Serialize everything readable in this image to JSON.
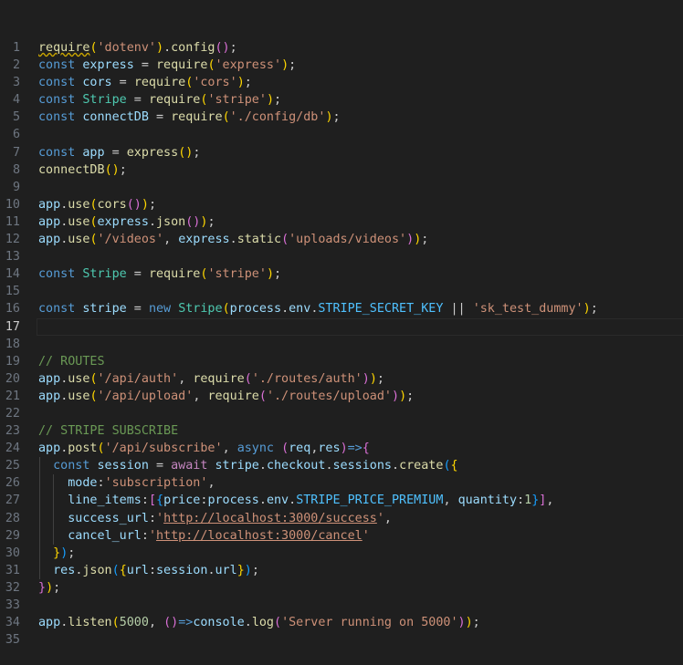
{
  "editor": {
    "current_line": 17,
    "lines": [
      {
        "n": "1",
        "tokens": [
          [
            "fn",
            "require"
          ],
          [
            "b1",
            "("
          ],
          [
            "str",
            "'dotenv'"
          ],
          [
            "b1",
            ")"
          ],
          [
            "pun",
            "."
          ],
          [
            "fn",
            "config"
          ],
          [
            "b2",
            "()"
          ],
          [
            "pun",
            ";"
          ]
        ]
      },
      {
        "n": "2",
        "tokens": [
          [
            "kw",
            "const"
          ],
          [
            "pun",
            " "
          ],
          [
            "var",
            "express"
          ],
          [
            "pun",
            " = "
          ],
          [
            "fn",
            "require"
          ],
          [
            "b1",
            "("
          ],
          [
            "str",
            "'express'"
          ],
          [
            "b1",
            ")"
          ],
          [
            "pun",
            ";"
          ]
        ]
      },
      {
        "n": "3",
        "tokens": [
          [
            "kw",
            "const"
          ],
          [
            "pun",
            " "
          ],
          [
            "var",
            "cors"
          ],
          [
            "pun",
            " = "
          ],
          [
            "fn",
            "require"
          ],
          [
            "b1",
            "("
          ],
          [
            "str",
            "'cors'"
          ],
          [
            "b1",
            ")"
          ],
          [
            "pun",
            ";"
          ]
        ]
      },
      {
        "n": "4",
        "tokens": [
          [
            "kw",
            "const"
          ],
          [
            "pun",
            " "
          ],
          [
            "cls",
            "Stripe"
          ],
          [
            "pun",
            " = "
          ],
          [
            "fn",
            "require"
          ],
          [
            "b1",
            "("
          ],
          [
            "str",
            "'stripe'"
          ],
          [
            "b1",
            ")"
          ],
          [
            "pun",
            ";"
          ]
        ]
      },
      {
        "n": "5",
        "tokens": [
          [
            "kw",
            "const"
          ],
          [
            "pun",
            " "
          ],
          [
            "var",
            "connectDB"
          ],
          [
            "pun",
            " = "
          ],
          [
            "fn",
            "require"
          ],
          [
            "b1",
            "("
          ],
          [
            "str",
            "'./config/db'"
          ],
          [
            "b1",
            ")"
          ],
          [
            "pun",
            ";"
          ]
        ]
      },
      {
        "n": "6",
        "tokens": []
      },
      {
        "n": "7",
        "tokens": [
          [
            "kw",
            "const"
          ],
          [
            "pun",
            " "
          ],
          [
            "var",
            "app"
          ],
          [
            "pun",
            " = "
          ],
          [
            "fn",
            "express"
          ],
          [
            "b1",
            "()"
          ],
          [
            "pun",
            ";"
          ]
        ]
      },
      {
        "n": "8",
        "tokens": [
          [
            "fn",
            "connectDB"
          ],
          [
            "b1",
            "()"
          ],
          [
            "pun",
            ";"
          ]
        ]
      },
      {
        "n": "9",
        "tokens": []
      },
      {
        "n": "10",
        "tokens": [
          [
            "var",
            "app"
          ],
          [
            "pun",
            "."
          ],
          [
            "fn",
            "use"
          ],
          [
            "b1",
            "("
          ],
          [
            "fn",
            "cors"
          ],
          [
            "b2",
            "()"
          ],
          [
            "b1",
            ")"
          ],
          [
            "pun",
            ";"
          ]
        ]
      },
      {
        "n": "11",
        "tokens": [
          [
            "var",
            "app"
          ],
          [
            "pun",
            "."
          ],
          [
            "fn",
            "use"
          ],
          [
            "b1",
            "("
          ],
          [
            "var",
            "express"
          ],
          [
            "pun",
            "."
          ],
          [
            "fn",
            "json"
          ],
          [
            "b2",
            "()"
          ],
          [
            "b1",
            ")"
          ],
          [
            "pun",
            ";"
          ]
        ]
      },
      {
        "n": "12",
        "tokens": [
          [
            "var",
            "app"
          ],
          [
            "pun",
            "."
          ],
          [
            "fn",
            "use"
          ],
          [
            "b1",
            "("
          ],
          [
            "str",
            "'/videos'"
          ],
          [
            "pun",
            ", "
          ],
          [
            "var",
            "express"
          ],
          [
            "pun",
            "."
          ],
          [
            "fn",
            "static"
          ],
          [
            "b2",
            "("
          ],
          [
            "str",
            "'uploads/videos'"
          ],
          [
            "b2",
            ")"
          ],
          [
            "b1",
            ")"
          ],
          [
            "pun",
            ";"
          ]
        ]
      },
      {
        "n": "13",
        "tokens": []
      },
      {
        "n": "14",
        "tokens": [
          [
            "kw",
            "const"
          ],
          [
            "pun",
            " "
          ],
          [
            "cls",
            "Stripe"
          ],
          [
            "pun",
            " = "
          ],
          [
            "fn",
            "require"
          ],
          [
            "b1",
            "("
          ],
          [
            "str",
            "'stripe'"
          ],
          [
            "b1",
            ")"
          ],
          [
            "pun",
            ";"
          ]
        ]
      },
      {
        "n": "15",
        "tokens": []
      },
      {
        "n": "16",
        "tokens": [
          [
            "kw",
            "const"
          ],
          [
            "pun",
            " "
          ],
          [
            "var",
            "stripe"
          ],
          [
            "pun",
            " = "
          ],
          [
            "kw",
            "new"
          ],
          [
            "pun",
            " "
          ],
          [
            "cls",
            "Stripe"
          ],
          [
            "b1",
            "("
          ],
          [
            "var",
            "process"
          ],
          [
            "pun",
            "."
          ],
          [
            "var",
            "env"
          ],
          [
            "pun",
            "."
          ],
          [
            "const",
            "STRIPE_SECRET_KEY"
          ],
          [
            "pun",
            " || "
          ],
          [
            "str",
            "'sk_test_dummy'"
          ],
          [
            "b1",
            ")"
          ],
          [
            "pun",
            ";"
          ]
        ]
      },
      {
        "n": "17",
        "tokens": []
      },
      {
        "n": "18",
        "tokens": []
      },
      {
        "n": "19",
        "tokens": [
          [
            "cmt",
            "// ROUTES"
          ]
        ]
      },
      {
        "n": "20",
        "tokens": [
          [
            "var",
            "app"
          ],
          [
            "pun",
            "."
          ],
          [
            "fn",
            "use"
          ],
          [
            "b1",
            "("
          ],
          [
            "str",
            "'/api/auth'"
          ],
          [
            "pun",
            ", "
          ],
          [
            "fn",
            "require"
          ],
          [
            "b2",
            "("
          ],
          [
            "str",
            "'./routes/auth'"
          ],
          [
            "b2",
            ")"
          ],
          [
            "b1",
            ")"
          ],
          [
            "pun",
            ";"
          ]
        ]
      },
      {
        "n": "21",
        "tokens": [
          [
            "var",
            "app"
          ],
          [
            "pun",
            "."
          ],
          [
            "fn",
            "use"
          ],
          [
            "b1",
            "("
          ],
          [
            "str",
            "'/api/upload'"
          ],
          [
            "pun",
            ", "
          ],
          [
            "fn",
            "require"
          ],
          [
            "b2",
            "("
          ],
          [
            "str",
            "'./routes/upload'"
          ],
          [
            "b2",
            ")"
          ],
          [
            "b1",
            ")"
          ],
          [
            "pun",
            ";"
          ]
        ]
      },
      {
        "n": "22",
        "tokens": []
      },
      {
        "n": "23",
        "tokens": [
          [
            "cmt",
            "// STRIPE SUBSCRIBE"
          ]
        ]
      },
      {
        "n": "24",
        "tokens": [
          [
            "var",
            "app"
          ],
          [
            "pun",
            "."
          ],
          [
            "fn",
            "post"
          ],
          [
            "b1",
            "("
          ],
          [
            "str",
            "'/api/subscribe'"
          ],
          [
            "pun",
            ", "
          ],
          [
            "kw",
            "async"
          ],
          [
            "pun",
            " "
          ],
          [
            "b2",
            "("
          ],
          [
            "var",
            "req"
          ],
          [
            "pun",
            ","
          ],
          [
            "var",
            "res"
          ],
          [
            "b2",
            ")"
          ],
          [
            "kw",
            "=>"
          ],
          [
            "b2",
            "{"
          ]
        ]
      },
      {
        "n": "25",
        "tokens": [
          [
            "pun",
            "  "
          ],
          [
            "kw",
            "const"
          ],
          [
            "pun",
            " "
          ],
          [
            "var",
            "session"
          ],
          [
            "pun",
            " = "
          ],
          [
            "kw2",
            "await"
          ],
          [
            "pun",
            " "
          ],
          [
            "var",
            "stripe"
          ],
          [
            "pun",
            "."
          ],
          [
            "var",
            "checkout"
          ],
          [
            "pun",
            "."
          ],
          [
            "var",
            "sessions"
          ],
          [
            "pun",
            "."
          ],
          [
            "fn",
            "create"
          ],
          [
            "b3",
            "("
          ],
          [
            "b1",
            "{"
          ]
        ]
      },
      {
        "n": "26",
        "tokens": [
          [
            "pun",
            "    "
          ],
          [
            "var",
            "mode"
          ],
          [
            "pun",
            ":"
          ],
          [
            "str",
            "'subscription'"
          ],
          [
            "pun",
            ","
          ]
        ]
      },
      {
        "n": "27",
        "tokens": [
          [
            "pun",
            "    "
          ],
          [
            "var",
            "line_items"
          ],
          [
            "pun",
            ":"
          ],
          [
            "b2",
            "["
          ],
          [
            "b3",
            "{"
          ],
          [
            "var",
            "price"
          ],
          [
            "pun",
            ":"
          ],
          [
            "var",
            "process"
          ],
          [
            "pun",
            "."
          ],
          [
            "var",
            "env"
          ],
          [
            "pun",
            "."
          ],
          [
            "const",
            "STRIPE_PRICE_PREMIUM"
          ],
          [
            "pun",
            ", "
          ],
          [
            "var",
            "quantity"
          ],
          [
            "pun",
            ":"
          ],
          [
            "num",
            "1"
          ],
          [
            "b3",
            "}"
          ],
          [
            "b2",
            "]"
          ],
          [
            "pun",
            ","
          ]
        ]
      },
      {
        "n": "28",
        "tokens": [
          [
            "pun",
            "    "
          ],
          [
            "var",
            "success_url"
          ],
          [
            "pun",
            ":"
          ],
          [
            "str",
            "'"
          ],
          [
            "url",
            "http://localhost:3000/success"
          ],
          [
            "str",
            "'"
          ],
          [
            "pun",
            ","
          ]
        ]
      },
      {
        "n": "29",
        "tokens": [
          [
            "pun",
            "    "
          ],
          [
            "var",
            "cancel_url"
          ],
          [
            "pun",
            ":"
          ],
          [
            "str",
            "'"
          ],
          [
            "url",
            "http://localhost:3000/cancel"
          ],
          [
            "str",
            "'"
          ]
        ]
      },
      {
        "n": "30",
        "tokens": [
          [
            "pun",
            "  "
          ],
          [
            "b1",
            "}"
          ],
          [
            "b3",
            ")"
          ],
          [
            "pun",
            ";"
          ]
        ]
      },
      {
        "n": "31",
        "tokens": [
          [
            "pun",
            "  "
          ],
          [
            "var",
            "res"
          ],
          [
            "pun",
            "."
          ],
          [
            "fn",
            "json"
          ],
          [
            "b3",
            "("
          ],
          [
            "b1",
            "{"
          ],
          [
            "var",
            "url"
          ],
          [
            "pun",
            ":"
          ],
          [
            "var",
            "session"
          ],
          [
            "pun",
            "."
          ],
          [
            "var",
            "url"
          ],
          [
            "b1",
            "}"
          ],
          [
            "b3",
            ")"
          ],
          [
            "pun",
            ";"
          ]
        ]
      },
      {
        "n": "32",
        "tokens": [
          [
            "b2",
            "}"
          ],
          [
            "b1",
            ")"
          ],
          [
            "pun",
            ";"
          ]
        ]
      },
      {
        "n": "33",
        "tokens": []
      },
      {
        "n": "34",
        "tokens": [
          [
            "var",
            "app"
          ],
          [
            "pun",
            "."
          ],
          [
            "fn",
            "listen"
          ],
          [
            "b1",
            "("
          ],
          [
            "num",
            "5000"
          ],
          [
            "pun",
            ", "
          ],
          [
            "b2",
            "()"
          ],
          [
            "kw",
            "=>"
          ],
          [
            "var",
            "console"
          ],
          [
            "pun",
            "."
          ],
          [
            "fn",
            "log"
          ],
          [
            "b2",
            "("
          ],
          [
            "str",
            "'Server running on 5000'"
          ],
          [
            "b2",
            ")"
          ],
          [
            "b1",
            ")"
          ],
          [
            "pun",
            ";"
          ]
        ]
      },
      {
        "n": "35",
        "tokens": []
      }
    ]
  }
}
